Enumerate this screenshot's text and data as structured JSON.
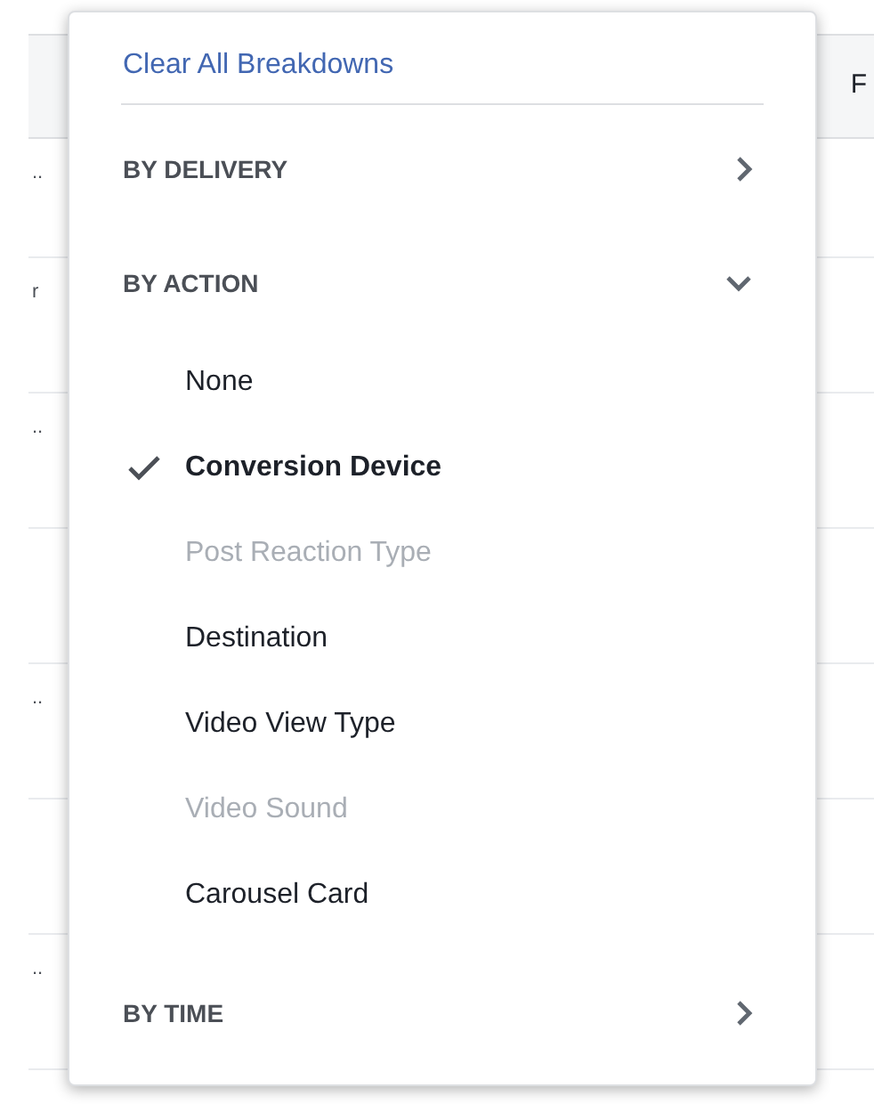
{
  "table": {
    "header": {
      "column_2": "F"
    },
    "rows": [
      {
        "column_1": ".."
      },
      {
        "column_1": "r"
      },
      {
        "column_1": ".."
      },
      {},
      {
        "column_1": ".."
      },
      {},
      {
        "column_1": ".."
      }
    ]
  },
  "menu": {
    "clear_link": "Clear All Breakdowns",
    "sections": [
      {
        "title": "BY DELIVERY",
        "expanded": false
      },
      {
        "title": "BY ACTION",
        "expanded": true,
        "items": [
          {
            "label": "None",
            "checked": false,
            "disabled": false
          },
          {
            "label": "Conversion Device",
            "checked": true,
            "disabled": false
          },
          {
            "label": "Post Reaction Type",
            "checked": false,
            "disabled": true
          },
          {
            "label": "Destination",
            "checked": false,
            "disabled": false
          },
          {
            "label": "Video View Type",
            "checked": false,
            "disabled": false
          },
          {
            "label": "Video Sound",
            "checked": false,
            "disabled": true
          },
          {
            "label": "Carousel Card",
            "checked": false,
            "disabled": false
          }
        ]
      },
      {
        "title": "BY TIME",
        "expanded": false
      }
    ]
  }
}
